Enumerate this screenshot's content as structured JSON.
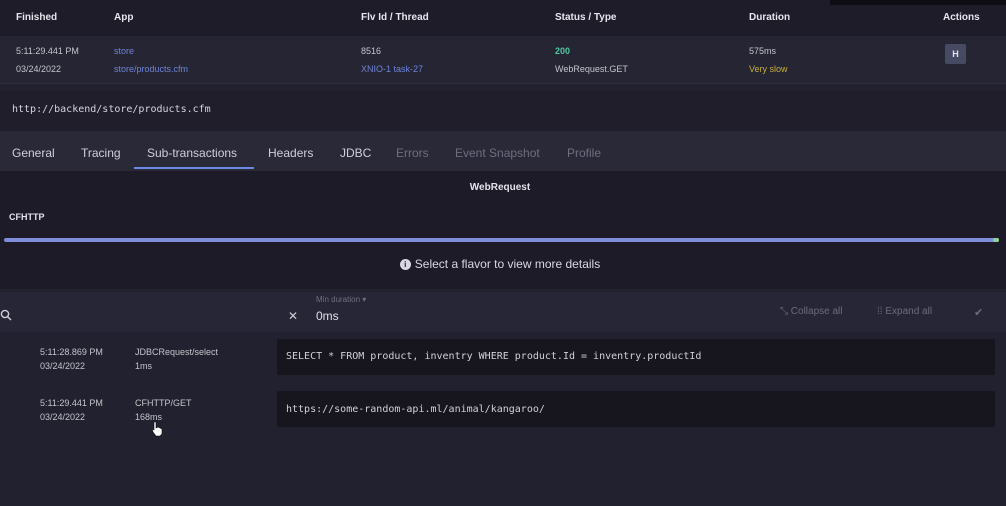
{
  "header": {
    "finished": "Finished",
    "app": "App",
    "fiv_thread": "Flv Id / Thread",
    "status_type": "Status / Type",
    "duration": "Duration",
    "actions": "Actions"
  },
  "transaction": {
    "time": "5:11:29.441 PM",
    "date": "03/24/2022",
    "app": "store",
    "app_path": "store/products.cfm",
    "flv_id": "8516",
    "thread": "XNIO-1 task-27",
    "status": "200",
    "type": "WebRequest.GET",
    "duration": "575ms",
    "duration_note": "Very slow",
    "action_label": "H"
  },
  "url": "http://backend/store/products.cfm",
  "tabs": [
    {
      "label": "General"
    },
    {
      "label": "Tracing"
    },
    {
      "label": "Sub-transactions"
    },
    {
      "label": "Headers"
    },
    {
      "label": "JDBC"
    },
    {
      "label": "Errors"
    },
    {
      "label": "Event Snapshot"
    },
    {
      "label": "Profile"
    }
  ],
  "active_tab": "Sub-transactions",
  "waterfall": {
    "title": "WebRequest",
    "lane_label": "CFHTTP",
    "info": "Select a flavor to view more details"
  },
  "filter": {
    "min_duration_label": "Min duration ▾",
    "min_duration_value": "0ms",
    "collapse_all": "Collapse all",
    "expand_all": "Expand all"
  },
  "subtransactions": [
    {
      "time": "5:11:28.869 PM",
      "date": "03/24/2022",
      "name": "JDBCRequest/select",
      "duration": "1ms",
      "detail": "SELECT * FROM product, inventry WHERE product.Id = inventry.productId"
    },
    {
      "time": "5:11:29.441 PM",
      "date": "03/24/2022",
      "name": "CFHTTP/GET",
      "duration": "168ms",
      "detail": "https://some-random-api.ml/animal/kangaroo/"
    }
  ],
  "colors": {
    "accent": "#6a8ae6",
    "status_ok": "#4fc7a1",
    "very_slow": "#c4b035",
    "link": "#6e83d8"
  }
}
